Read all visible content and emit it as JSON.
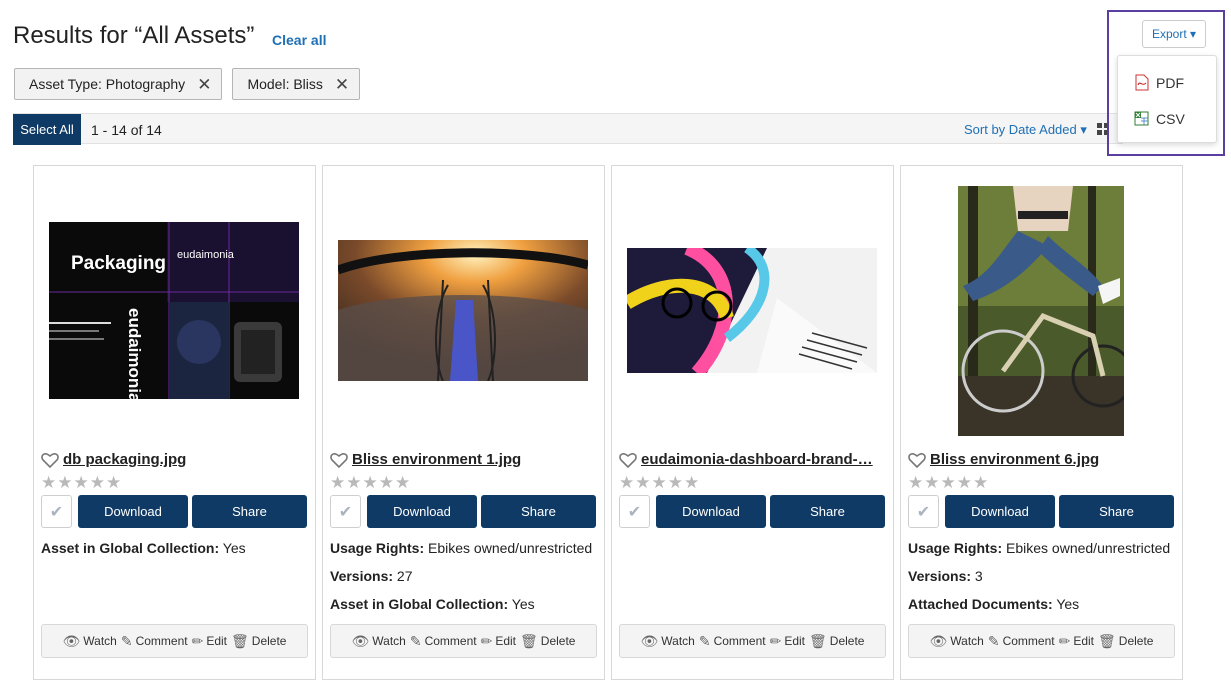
{
  "header": {
    "title": "Results for “All Assets”",
    "clear_all": "Clear all"
  },
  "filters": [
    {
      "label": "Asset Type: Photography"
    },
    {
      "label": "Model: Bliss"
    }
  ],
  "toolbar": {
    "select_all": "Select All",
    "count": "1 - 14 of 14",
    "sort": "Sort by Date Added"
  },
  "export": {
    "label": "Export",
    "items": [
      {
        "label": "PDF",
        "icon": "pdf-file-icon"
      },
      {
        "label": "CSV",
        "icon": "spreadsheet-file-icon"
      }
    ]
  },
  "actions": {
    "download": "Download",
    "share": "Share",
    "watch": "Watch",
    "comment": "Comment",
    "edit": "Edit",
    "delete": "Delete"
  },
  "packaging_texts": [
    "Packaging",
    "eudaimonia",
    "eudaimonia"
  ],
  "cards": [
    {
      "name": "db packaging.jpg",
      "meta": [
        {
          "key": "Asset in Global Collection:",
          "value": "Yes"
        }
      ]
    },
    {
      "name": "Bliss environment 1.jpg",
      "meta": [
        {
          "key": "Usage Rights:",
          "value": "Ebikes owned/unrestricted"
        },
        {
          "key": "Versions:",
          "value": "27"
        },
        {
          "key": "Asset in Global Collection:",
          "value": "Yes"
        }
      ]
    },
    {
      "name": "eudaimonia-dashboard-brand-…",
      "meta": []
    },
    {
      "name": "Bliss environment 6.jpg",
      "meta": [
        {
          "key": "Usage Rights:",
          "value": "Ebikes owned/unrestricted"
        },
        {
          "key": "Versions:",
          "value": "3"
        },
        {
          "key": "Attached Documents:",
          "value": "Yes"
        }
      ]
    }
  ],
  "colors": {
    "primary": "#0f3a66",
    "link": "#1f6fb5",
    "highlight": "#5b3fa0"
  }
}
